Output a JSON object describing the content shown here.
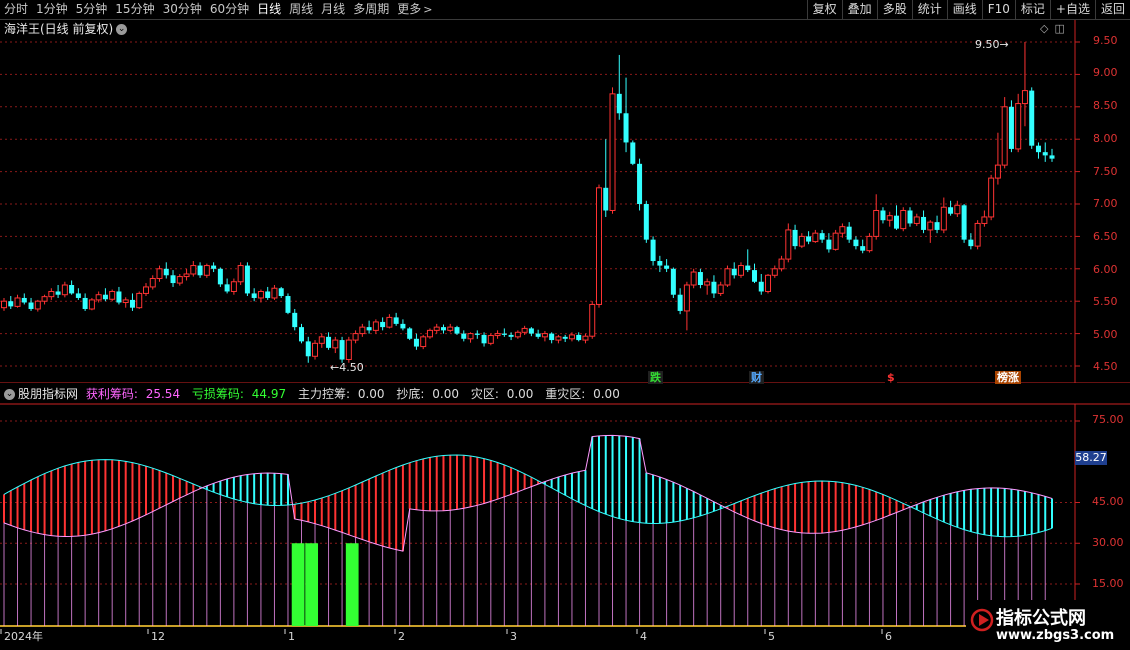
{
  "toolbar": {
    "periods": [
      "分时",
      "1分钟",
      "5分钟",
      "15分钟",
      "30分钟",
      "60分钟",
      "日线",
      "周线",
      "月线",
      "多周期",
      "更多"
    ],
    "active_period": "日线",
    "actions": [
      "复权",
      "叠加",
      "多股",
      "统计",
      "画线",
      "F10",
      "标记",
      "+自选",
      "返回"
    ]
  },
  "main": {
    "title": "海洋王(日线 前复权)",
    "y_labels": [
      "9.50",
      "9.00",
      "8.50",
      "8.00",
      "7.50",
      "7.00",
      "6.50",
      "6.00",
      "5.50",
      "5.00",
      "4.50"
    ],
    "min_label": "4.50",
    "max_label": "9.50",
    "events": [
      {
        "text": "跌",
        "color": "#33dd33",
        "bg": "#202020"
      },
      {
        "text": "财",
        "color": "#55aaff",
        "bg": "#202020"
      },
      {
        "text": "$",
        "color": "#ff3333",
        "bg": "#000000"
      },
      {
        "text": "榜涨",
        "color": "#ffffff",
        "bg": "#aa4400"
      }
    ]
  },
  "indicator": {
    "name": "股朋指标网",
    "items": [
      {
        "label": "获利筹码:",
        "value": "25.54",
        "color": "#ff66ff"
      },
      {
        "label": "亏损筹码:",
        "value": "44.97",
        "color": "#33ffff"
      },
      {
        "label": "主力控筹:",
        "value": "0.00",
        "color": "#ff3333"
      },
      {
        "label": "抄底:",
        "value": "0.00",
        "color": "#33ff33"
      },
      {
        "label": "灾区:",
        "value": "0.00",
        "color": "#cc66ff"
      },
      {
        "label": "重灾区:",
        "value": "0.00",
        "color": "#ffff66"
      }
    ],
    "y_labels": [
      "75.00",
      "45.00",
      "30.00",
      "15.00"
    ],
    "current_value": "58.27"
  },
  "date_axis": [
    "2024年",
    "12",
    "1",
    "2",
    "3",
    "4",
    "5",
    "6"
  ],
  "watermark": {
    "title": "指标公式网",
    "url": "www.zbgs3.com"
  },
  "colors": {
    "up": "#ff3333",
    "down": "#33ffff",
    "grid": "#8a1a1a",
    "axis": "#cc2222",
    "profit": "#ff99ff",
    "bottom": "#33ff33"
  },
  "chart_data": {
    "type": "candlestick",
    "title": "海洋王(日线 前复权)",
    "ylim": [
      4.3,
      9.75
    ],
    "candles": [
      [
        5.4,
        5.55,
        5.35,
        5.5
      ],
      [
        5.5,
        5.58,
        5.38,
        5.42
      ],
      [
        5.42,
        5.6,
        5.4,
        5.55
      ],
      [
        5.55,
        5.62,
        5.45,
        5.48
      ],
      [
        5.48,
        5.55,
        5.35,
        5.38
      ],
      [
        5.38,
        5.52,
        5.34,
        5.5
      ],
      [
        5.5,
        5.6,
        5.45,
        5.57
      ],
      [
        5.57,
        5.7,
        5.52,
        5.65
      ],
      [
        5.65,
        5.75,
        5.55,
        5.6
      ],
      [
        5.6,
        5.8,
        5.56,
        5.75
      ],
      [
        5.75,
        5.82,
        5.6,
        5.62
      ],
      [
        5.62,
        5.7,
        5.52,
        5.55
      ],
      [
        5.55,
        5.62,
        5.35,
        5.38
      ],
      [
        5.38,
        5.55,
        5.36,
        5.52
      ],
      [
        5.52,
        5.65,
        5.48,
        5.6
      ],
      [
        5.6,
        5.7,
        5.5,
        5.53
      ],
      [
        5.53,
        5.68,
        5.5,
        5.65
      ],
      [
        5.65,
        5.72,
        5.45,
        5.48
      ],
      [
        5.48,
        5.56,
        5.4,
        5.52
      ],
      [
        5.52,
        5.62,
        5.35,
        5.4
      ],
      [
        5.4,
        5.65,
        5.38,
        5.62
      ],
      [
        5.62,
        5.78,
        5.58,
        5.72
      ],
      [
        5.72,
        5.9,
        5.68,
        5.85
      ],
      [
        5.85,
        6.05,
        5.8,
        6.0
      ],
      [
        6.0,
        6.1,
        5.85,
        5.9
      ],
      [
        5.9,
        5.98,
        5.72,
        5.78
      ],
      [
        5.78,
        5.92,
        5.74,
        5.88
      ],
      [
        5.88,
        6.0,
        5.82,
        5.92
      ],
      [
        5.92,
        6.12,
        5.88,
        6.05
      ],
      [
        6.05,
        6.1,
        5.86,
        5.9
      ],
      [
        5.9,
        6.08,
        5.86,
        6.05
      ],
      [
        6.05,
        6.1,
        5.95,
        6.0
      ],
      [
        6.0,
        6.02,
        5.72,
        5.76
      ],
      [
        5.76,
        5.85,
        5.62,
        5.65
      ],
      [
        5.65,
        5.85,
        5.6,
        5.8
      ],
      [
        5.8,
        6.1,
        5.75,
        6.05
      ],
      [
        6.05,
        6.1,
        5.58,
        5.62
      ],
      [
        5.62,
        5.7,
        5.5,
        5.55
      ],
      [
        5.55,
        5.68,
        5.48,
        5.65
      ],
      [
        5.65,
        5.72,
        5.52,
        5.55
      ],
      [
        5.55,
        5.75,
        5.52,
        5.7
      ],
      [
        5.7,
        5.72,
        5.55,
        5.58
      ],
      [
        5.58,
        5.62,
        5.3,
        5.32
      ],
      [
        5.32,
        5.38,
        5.05,
        5.1
      ],
      [
        5.1,
        5.15,
        4.85,
        4.88
      ],
      [
        4.88,
        4.95,
        4.55,
        4.65
      ],
      [
        4.65,
        4.9,
        4.6,
        4.85
      ],
      [
        4.85,
        5.0,
        4.78,
        4.95
      ],
      [
        4.95,
        5.02,
        4.75,
        4.78
      ],
      [
        4.78,
        4.95,
        4.7,
        4.9
      ],
      [
        4.9,
        4.95,
        4.55,
        4.6
      ],
      [
        4.6,
        4.95,
        4.55,
        4.9
      ],
      [
        4.9,
        5.05,
        4.85,
        5.0
      ],
      [
        5.0,
        5.15,
        4.95,
        5.1
      ],
      [
        5.1,
        5.2,
        5.0,
        5.05
      ],
      [
        5.05,
        5.22,
        5.0,
        5.18
      ],
      [
        5.18,
        5.25,
        5.05,
        5.1
      ],
      [
        5.1,
        5.3,
        5.08,
        5.25
      ],
      [
        5.25,
        5.32,
        5.12,
        5.15
      ],
      [
        5.15,
        5.22,
        5.05,
        5.08
      ],
      [
        5.08,
        5.1,
        4.9,
        4.92
      ],
      [
        4.92,
        5.0,
        4.75,
        4.8
      ],
      [
        4.8,
        4.98,
        4.76,
        4.95
      ],
      [
        4.95,
        5.08,
        4.92,
        5.05
      ],
      [
        5.05,
        5.15,
        5.0,
        5.1
      ],
      [
        5.1,
        5.14,
        5.0,
        5.05
      ],
      [
        5.05,
        5.15,
        5.02,
        5.1
      ],
      [
        5.1,
        5.12,
        4.98,
        5.0
      ],
      [
        5.0,
        5.05,
        4.88,
        4.92
      ],
      [
        4.92,
        5.02,
        4.86,
        5.0
      ],
      [
        5.0,
        5.05,
        4.92,
        4.98
      ],
      [
        4.98,
        5.02,
        4.8,
        4.85
      ],
      [
        4.85,
        5.0,
        4.82,
        4.97
      ],
      [
        4.97,
        5.05,
        4.92,
        5.0
      ],
      [
        5.0,
        5.08,
        4.95,
        4.98
      ],
      [
        4.98,
        5.02,
        4.9,
        4.95
      ],
      [
        4.95,
        5.05,
        4.92,
        5.02
      ],
      [
        5.02,
        5.12,
        4.98,
        5.08
      ],
      [
        5.08,
        5.1,
        4.96,
        5.0
      ],
      [
        5.0,
        5.06,
        4.92,
        4.95
      ],
      [
        4.95,
        5.04,
        4.88,
        5.0
      ],
      [
        5.0,
        5.02,
        4.85,
        4.9
      ],
      [
        4.9,
        4.98,
        4.85,
        4.95
      ],
      [
        4.95,
        4.98,
        4.87,
        4.92
      ],
      [
        4.92,
        5.02,
        4.88,
        4.98
      ],
      [
        4.98,
        5.02,
        4.88,
        4.9
      ],
      [
        4.9,
        5.0,
        4.85,
        4.96
      ],
      [
        4.96,
        5.5,
        4.92,
        5.45
      ],
      [
        5.45,
        7.3,
        5.4,
        7.25
      ],
      [
        7.25,
        8.0,
        6.8,
        6.9
      ],
      [
        6.9,
        8.8,
        6.85,
        8.7
      ],
      [
        8.7,
        9.3,
        8.3,
        8.4
      ],
      [
        8.4,
        8.95,
        7.8,
        7.95
      ],
      [
        7.95,
        7.98,
        7.6,
        7.62
      ],
      [
        7.62,
        7.7,
        6.9,
        7.0
      ],
      [
        7.0,
        7.05,
        6.4,
        6.45
      ],
      [
        6.45,
        6.5,
        6.05,
        6.12
      ],
      [
        6.12,
        6.2,
        5.95,
        6.05
      ],
      [
        6.05,
        6.15,
        5.95,
        6.0
      ],
      [
        6.0,
        6.02,
        5.55,
        5.6
      ],
      [
        5.6,
        5.7,
        5.3,
        5.35
      ],
      [
        5.35,
        5.8,
        5.05,
        5.75
      ],
      [
        5.75,
        6.0,
        5.7,
        5.95
      ],
      [
        5.95,
        6.0,
        5.7,
        5.75
      ],
      [
        5.75,
        5.85,
        5.6,
        5.8
      ],
      [
        5.8,
        5.9,
        5.55,
        5.62
      ],
      [
        5.62,
        5.8,
        5.58,
        5.75
      ],
      [
        5.75,
        6.05,
        5.72,
        6.0
      ],
      [
        6.0,
        6.1,
        5.85,
        5.9
      ],
      [
        5.9,
        6.1,
        5.86,
        6.05
      ],
      [
        6.05,
        6.3,
        5.95,
        5.98
      ],
      [
        5.98,
        6.08,
        5.78,
        5.8
      ],
      [
        5.8,
        5.92,
        5.6,
        5.65
      ],
      [
        5.65,
        5.92,
        5.62,
        5.9
      ],
      [
        5.9,
        6.05,
        5.86,
        6.0
      ],
      [
        6.0,
        6.2,
        5.96,
        6.15
      ],
      [
        6.15,
        6.7,
        6.1,
        6.6
      ],
      [
        6.6,
        6.68,
        6.3,
        6.35
      ],
      [
        6.35,
        6.55,
        6.32,
        6.5
      ],
      [
        6.5,
        6.58,
        6.38,
        6.42
      ],
      [
        6.42,
        6.6,
        6.4,
        6.55
      ],
      [
        6.55,
        6.6,
        6.4,
        6.45
      ],
      [
        6.45,
        6.55,
        6.25,
        6.3
      ],
      [
        6.3,
        6.6,
        6.28,
        6.55
      ],
      [
        6.55,
        6.7,
        6.48,
        6.65
      ],
      [
        6.65,
        6.72,
        6.4,
        6.45
      ],
      [
        6.45,
        6.5,
        6.3,
        6.35
      ],
      [
        6.35,
        6.45,
        6.24,
        6.28
      ],
      [
        6.28,
        6.55,
        6.25,
        6.5
      ],
      [
        6.5,
        7.15,
        6.45,
        6.9
      ],
      [
        6.9,
        6.95,
        6.7,
        6.75
      ],
      [
        6.75,
        6.88,
        6.65,
        6.82
      ],
      [
        6.82,
        6.98,
        6.6,
        6.62
      ],
      [
        6.62,
        6.95,
        6.58,
        6.9
      ],
      [
        6.9,
        6.95,
        6.65,
        6.7
      ],
      [
        6.7,
        6.85,
        6.66,
        6.8
      ],
      [
        6.8,
        6.9,
        6.55,
        6.6
      ],
      [
        6.6,
        6.75,
        6.4,
        6.72
      ],
      [
        6.72,
        6.82,
        6.55,
        6.6
      ],
      [
        6.6,
        7.1,
        6.55,
        6.95
      ],
      [
        6.95,
        7.05,
        6.82,
        6.85
      ],
      [
        6.85,
        7.05,
        6.8,
        6.98
      ],
      [
        6.98,
        7.0,
        6.4,
        6.45
      ],
      [
        6.45,
        6.55,
        6.3,
        6.35
      ],
      [
        6.35,
        6.75,
        6.3,
        6.7
      ],
      [
        6.7,
        6.9,
        6.65,
        6.8
      ],
      [
        6.8,
        7.45,
        6.75,
        7.4
      ],
      [
        7.4,
        8.1,
        7.3,
        7.6
      ],
      [
        7.6,
        8.65,
        7.55,
        8.5
      ],
      [
        8.5,
        8.6,
        7.8,
        7.85
      ],
      [
        7.85,
        8.7,
        7.8,
        8.55
      ],
      [
        8.55,
        9.5,
        8.2,
        8.75
      ],
      [
        8.75,
        8.8,
        7.85,
        7.9
      ],
      [
        7.9,
        7.95,
        7.7,
        7.8
      ],
      [
        7.8,
        7.95,
        7.65,
        7.75
      ],
      [
        7.75,
        7.85,
        7.65,
        7.7
      ]
    ]
  }
}
